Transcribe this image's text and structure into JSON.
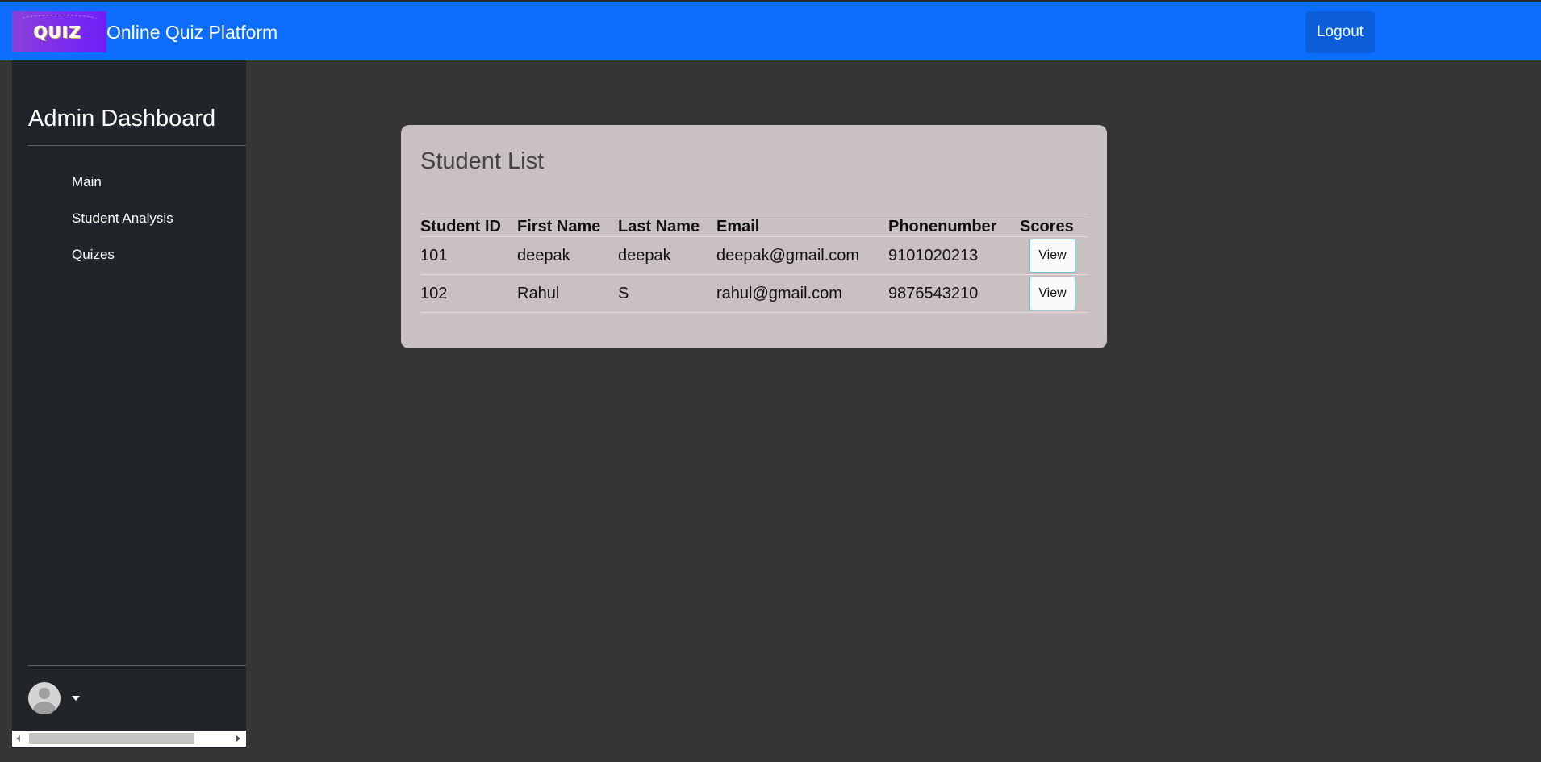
{
  "header": {
    "logo_text": "QUIZ",
    "app_title": "Online Quiz Platform",
    "logout_label": "Logout",
    "brand_color": "#0d6efd"
  },
  "sidebar": {
    "title": "Admin Dashboard",
    "items": [
      {
        "label": "Main"
      },
      {
        "label": "Student Analysis"
      },
      {
        "label": "Quizes"
      }
    ]
  },
  "main": {
    "card_title": "Student List",
    "columns": [
      "Student ID",
      "First Name",
      "Last Name",
      "Email",
      "Phonenumber",
      "Scores"
    ],
    "rows": [
      {
        "student_id": "101",
        "first_name": "deepak",
        "last_name": "deepak",
        "email": "deepak@gmail.com",
        "phone": "9101020213",
        "action": "View"
      },
      {
        "student_id": "102",
        "first_name": "Rahul",
        "last_name": "S",
        "email": "rahul@gmail.com",
        "phone": "9876543210",
        "action": "View"
      }
    ]
  }
}
